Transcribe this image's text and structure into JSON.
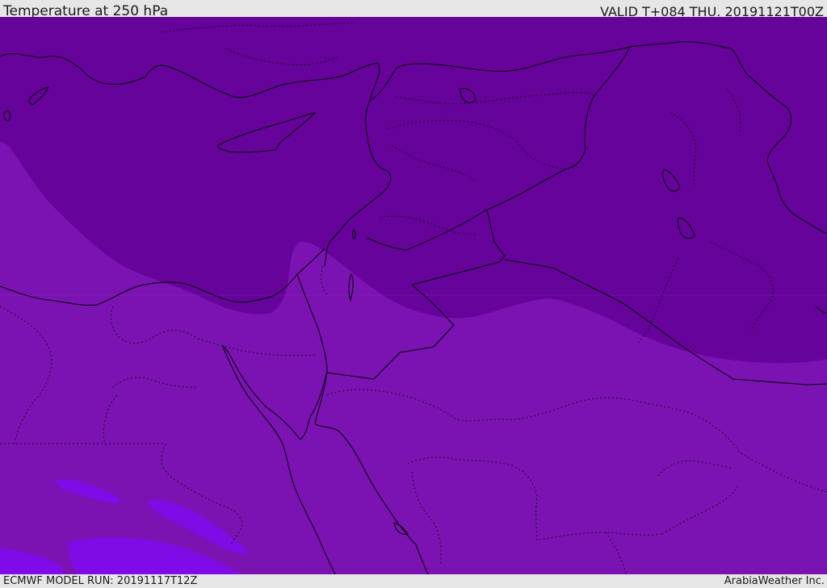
{
  "header": {
    "title": "Temperature at 250 hPa",
    "valid_time": "VALID T+084 THU. 20191121T00Z"
  },
  "footer": {
    "model_run": "ECMWF MODEL RUN: 20191117T12Z",
    "credit": "ArabiaWeather Inc."
  },
  "map": {
    "colors": {
      "background_band": "#7a13b2",
      "cold_band": "#66039a",
      "warm_band": "#7f0be6",
      "coastline": "#000000",
      "borders": "#1a0a2a"
    }
  }
}
